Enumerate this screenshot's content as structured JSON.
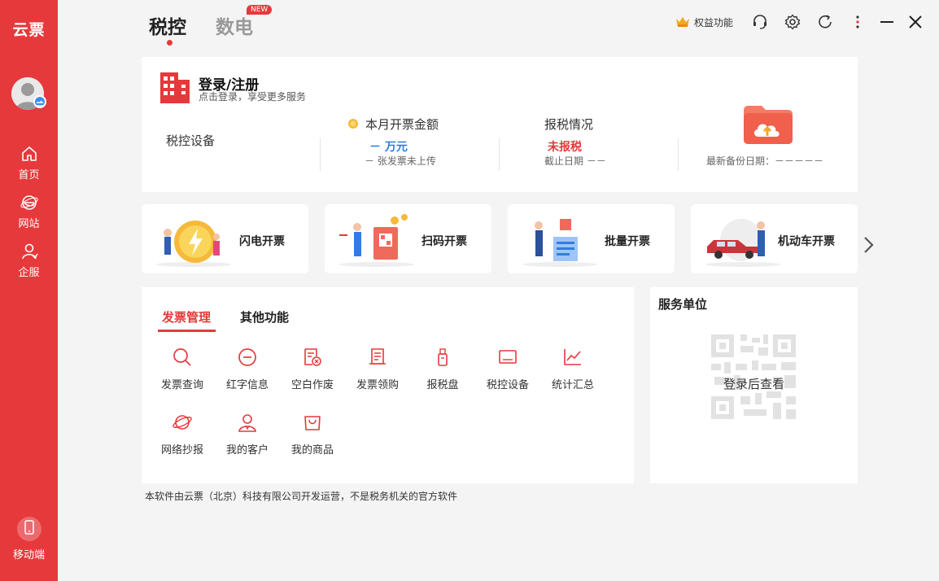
{
  "sidebar": {
    "brand": "云票",
    "nav": [
      {
        "label": "首页"
      },
      {
        "label": "网站"
      },
      {
        "label": "企服"
      }
    ],
    "mobile": "移动端"
  },
  "top": {
    "tabs": [
      {
        "label": "税控",
        "active": true
      },
      {
        "label": "数电",
        "active": false
      }
    ],
    "new_badge": "NEW",
    "vip_label": "权益功能"
  },
  "login": {
    "title": "登录/注册",
    "subtitle": "点击登录，享受更多服务",
    "device_label": "税控设备",
    "month_amount_label": "本月开票金额",
    "month_amount_value": "－ 万元",
    "unuploaded_note": "－ 张发票未上传",
    "tax_label": "报税情况",
    "tax_status": "未报税",
    "deadline_note": "截止日期 －－",
    "backup_note": "最新备份日期：－－－－－"
  },
  "quick_actions": [
    {
      "label": "闪电开票"
    },
    {
      "label": "扫码开票"
    },
    {
      "label": "批量开票"
    },
    {
      "label": "机动车开票"
    }
  ],
  "manage": {
    "tabs": [
      {
        "label": "发票管理",
        "active": true
      },
      {
        "label": "其他功能",
        "active": false
      }
    ],
    "functions": [
      {
        "label": "发票查询",
        "icon": "search-icon"
      },
      {
        "label": "红字信息",
        "icon": "minus-circle-icon"
      },
      {
        "label": "空白作废",
        "icon": "void-document-icon"
      },
      {
        "label": "发票领购",
        "icon": "invoice-icon"
      },
      {
        "label": "报税盘",
        "icon": "usb-key-icon"
      },
      {
        "label": "税控设备",
        "icon": "device-icon"
      },
      {
        "label": "统计汇总",
        "icon": "line-chart-icon"
      },
      {
        "label": "网络抄报",
        "icon": "planet-icon"
      },
      {
        "label": "我的客户",
        "icon": "customer-icon"
      },
      {
        "label": "我的商品",
        "icon": "shopping-bag-icon"
      }
    ]
  },
  "service": {
    "title": "服务单位",
    "qr_hint": "登录后查看"
  },
  "footer": "本软件由云票（北京）科技有限公司开发运营，不是税务机关的官方软件",
  "colors": {
    "brand_red": "#e6393c",
    "sidebar_bg": "#e6393c",
    "value_blue": "#2f7de1",
    "background": "#f4f4f4"
  }
}
